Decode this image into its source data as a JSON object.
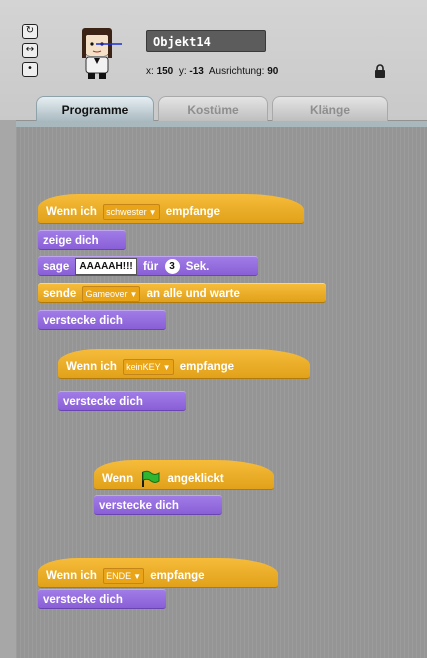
{
  "sprite": {
    "name": "Objekt14",
    "x_label": "x:",
    "x": "150",
    "y_label": "y:",
    "y": "-13",
    "direction_label": "Ausrichtung:",
    "direction": "90"
  },
  "tabs": [
    {
      "label": "Programme",
      "active": true
    },
    {
      "label": "Kostüme",
      "active": false
    },
    {
      "label": "Klänge",
      "active": false
    }
  ],
  "scripts": {
    "s1": {
      "hat_prefix": "Wenn ich",
      "hat_message": "schwester",
      "hat_suffix": "empfange",
      "show": "zeige dich",
      "say_label": "sage",
      "say_text": "AAAAAH!!!",
      "say_for": "für",
      "say_secs": "3",
      "say_unit": "Sek.",
      "send_label": "sende",
      "send_message": "Gameover",
      "send_suffix": "an alle und warte",
      "hide": "verstecke dich"
    },
    "s2": {
      "hat_prefix": "Wenn ich",
      "hat_message": "keinKEY",
      "hat_suffix": "empfange",
      "hide": "verstecke dich"
    },
    "s3": {
      "hat_prefix": "Wenn",
      "hat_suffix": "angeklickt",
      "hide": "verstecke dich"
    },
    "s4": {
      "hat_prefix": "Wenn ich",
      "hat_message": "ENDE",
      "hat_suffix": "empfange",
      "hide": "verstecke dich"
    }
  },
  "colors": {
    "control": "#e6a822",
    "looks": "#8f63da",
    "flag": "#2fb52f"
  }
}
